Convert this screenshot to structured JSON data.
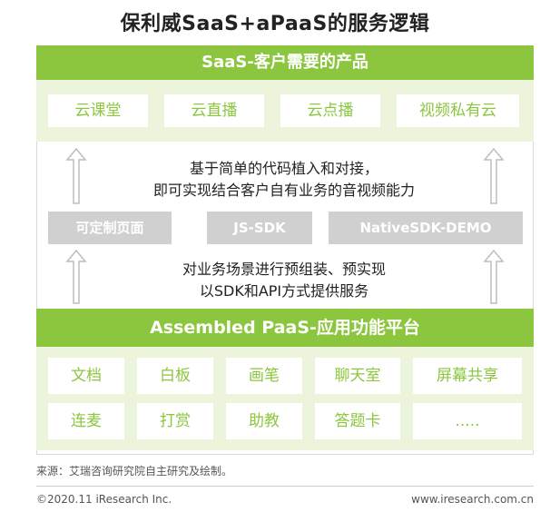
{
  "title": "保利威SaaS+aPaaS的服务逻辑",
  "saas": {
    "header": "SaaS-客户需要的产品",
    "products": [
      "云课堂",
      "云直播",
      "云点播",
      "视频私有云"
    ]
  },
  "desc_upper": [
    "基于简单的代码植入和对接，",
    "即可实现结合客户自有业务的音视频能力"
  ],
  "sdk": [
    "可定制页面",
    "JS-SDK",
    "NativeSDK-DEMO"
  ],
  "desc_lower": [
    "对业务场景进行预组装、预实现",
    "以SDK和API方式提供服务"
  ],
  "paas": {
    "header": "Assembled PaaS-应用功能平台",
    "row1": [
      "文档",
      "白板",
      "画笔",
      "聊天室",
      "屏幕共享"
    ],
    "row2": [
      "连麦",
      "打赏",
      "助教",
      "答题卡",
      "....."
    ]
  },
  "source": "来源：艾瑞咨询研究院自主研究及绘制。",
  "footer": {
    "copyright": "©2020.11 iResearch Inc.",
    "website": "www.iresearch.com.cn"
  },
  "colors": {
    "green": "#8cc63f",
    "light_green": "#ecf5dc",
    "gray": "#d0d0d0"
  },
  "icons": [
    "up-arrow-icon"
  ]
}
